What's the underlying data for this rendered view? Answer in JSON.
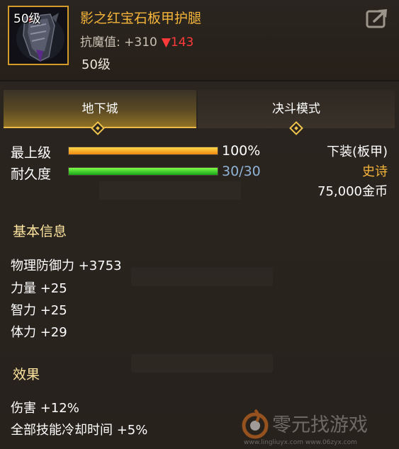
{
  "item": {
    "level_badge": "50级",
    "name": "影之红宝石板甲护腿",
    "magic_resistance_label": "抗魔值: +310",
    "magic_resistance_diff": "▼143",
    "required_level": "50级"
  },
  "tabs": [
    {
      "label": "地下城",
      "active": true
    },
    {
      "label": "决斗模式",
      "active": false
    }
  ],
  "bars": {
    "max_level": {
      "label": "最上级",
      "value_text": "100%",
      "fraction": 1.0
    },
    "durability": {
      "label": "耐久度",
      "value_text": "30/30",
      "fraction": 1.0
    }
  },
  "info": {
    "slot_type": "下装(板甲)",
    "rarity": "史诗",
    "price": "75,000金币"
  },
  "basic_info": {
    "title": "基本信息",
    "stats": [
      "物理防御力 +3753",
      "力量 +25",
      "智力 +25",
      "体力 +29"
    ]
  },
  "effects": {
    "title": "效果",
    "stats": [
      "伤害 +12%",
      "全部技能冷却时间 +5%"
    ]
  },
  "watermark": {
    "brand": "零元找游戏",
    "url": "www.lingliuyx.com   www.06zyx.com"
  },
  "colors": {
    "item_name": "#f5b43a",
    "frame_border": "#d29b2a",
    "diff_down": "#ff3a3a",
    "tab_active_accent": "#e9b949"
  },
  "icons": [
    "share-icon",
    "diamond-marker-icon",
    "leg-armor-icon",
    "watermark-logo-icon"
  ]
}
